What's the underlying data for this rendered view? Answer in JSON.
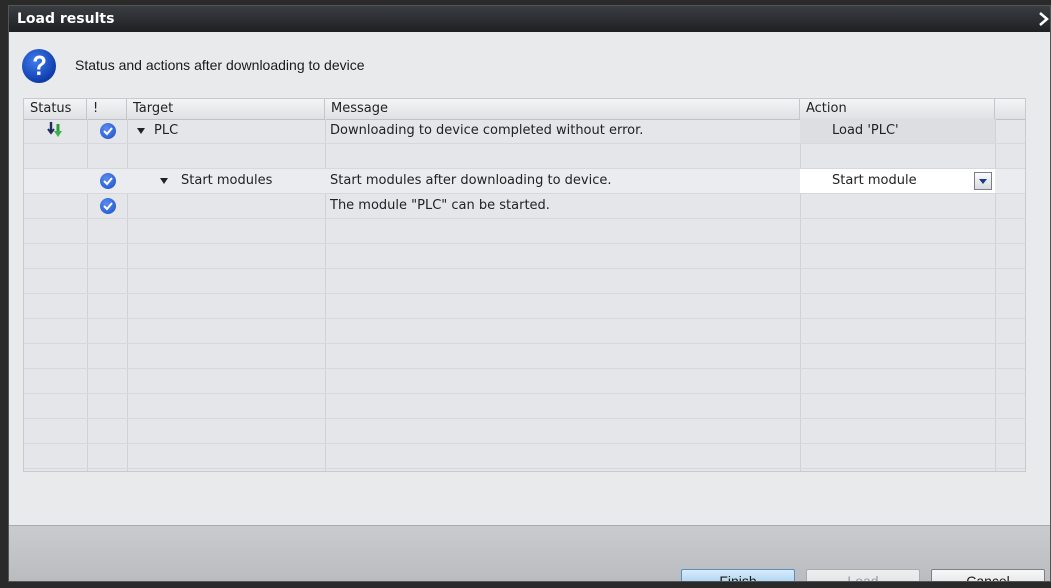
{
  "window": {
    "title": "Load results",
    "close_label": "×"
  },
  "header": {
    "text": "Status and actions after downloading to device"
  },
  "grid": {
    "columns": [
      "Status",
      "!",
      "Target",
      "Message",
      "Action"
    ],
    "rows": [
      {
        "status_icon": "download-arrow-icon",
        "check": true,
        "target": "PLC",
        "expanded": true,
        "message": "Downloading to device completed without error.",
        "action": "Load 'PLC'"
      },
      {
        "status_icon": "",
        "check": false,
        "target": "",
        "message": "",
        "action": ""
      },
      {
        "status_icon": "",
        "check": true,
        "target": "Start modules",
        "expanded": true,
        "message": "Start modules after downloading to device.",
        "action": "Start module",
        "action_dropdown": true
      },
      {
        "status_icon": "",
        "check": true,
        "target": "",
        "message": "The module \"PLC\" can be started.",
        "action": ""
      }
    ]
  },
  "footer": {
    "finish_label": "Finish",
    "load_label": "Load",
    "cancel_label": "Cancel"
  },
  "colors": {
    "title_bar": "#2b2e33",
    "check_blue": "#1b4fc9",
    "primary_button": "#8fc4ec"
  }
}
